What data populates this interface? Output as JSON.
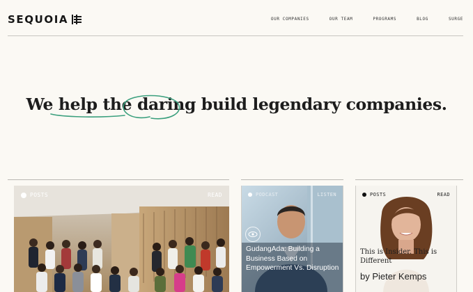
{
  "brand": {
    "name": "SEQUOIA"
  },
  "nav": {
    "items": [
      {
        "label": "OUR COMPANIES"
      },
      {
        "label": "OUR TEAM"
      },
      {
        "label": "PROGRAMS"
      },
      {
        "label": "BLOG"
      },
      {
        "label": "SURGE"
      }
    ]
  },
  "hero": {
    "headline": "We help the daring build legendary companies.",
    "accent_color": "#3a9f7d"
  },
  "cards": [
    {
      "tag": "POSTS",
      "action": "READ",
      "title": "",
      "author": ""
    },
    {
      "tag": "PODCAST",
      "action": "LISTEN",
      "title": "GudangAda: Building a Business Based on Empowerment Vs. Disruption",
      "author": ""
    },
    {
      "tag": "POSTS",
      "action": "READ",
      "title": "This is Insider. This is Different",
      "author": "by Pieter Kemps"
    }
  ],
  "colors": {
    "background": "#fbf9f4",
    "text": "#1c1c1c",
    "scribble": "#3a9f7d"
  }
}
